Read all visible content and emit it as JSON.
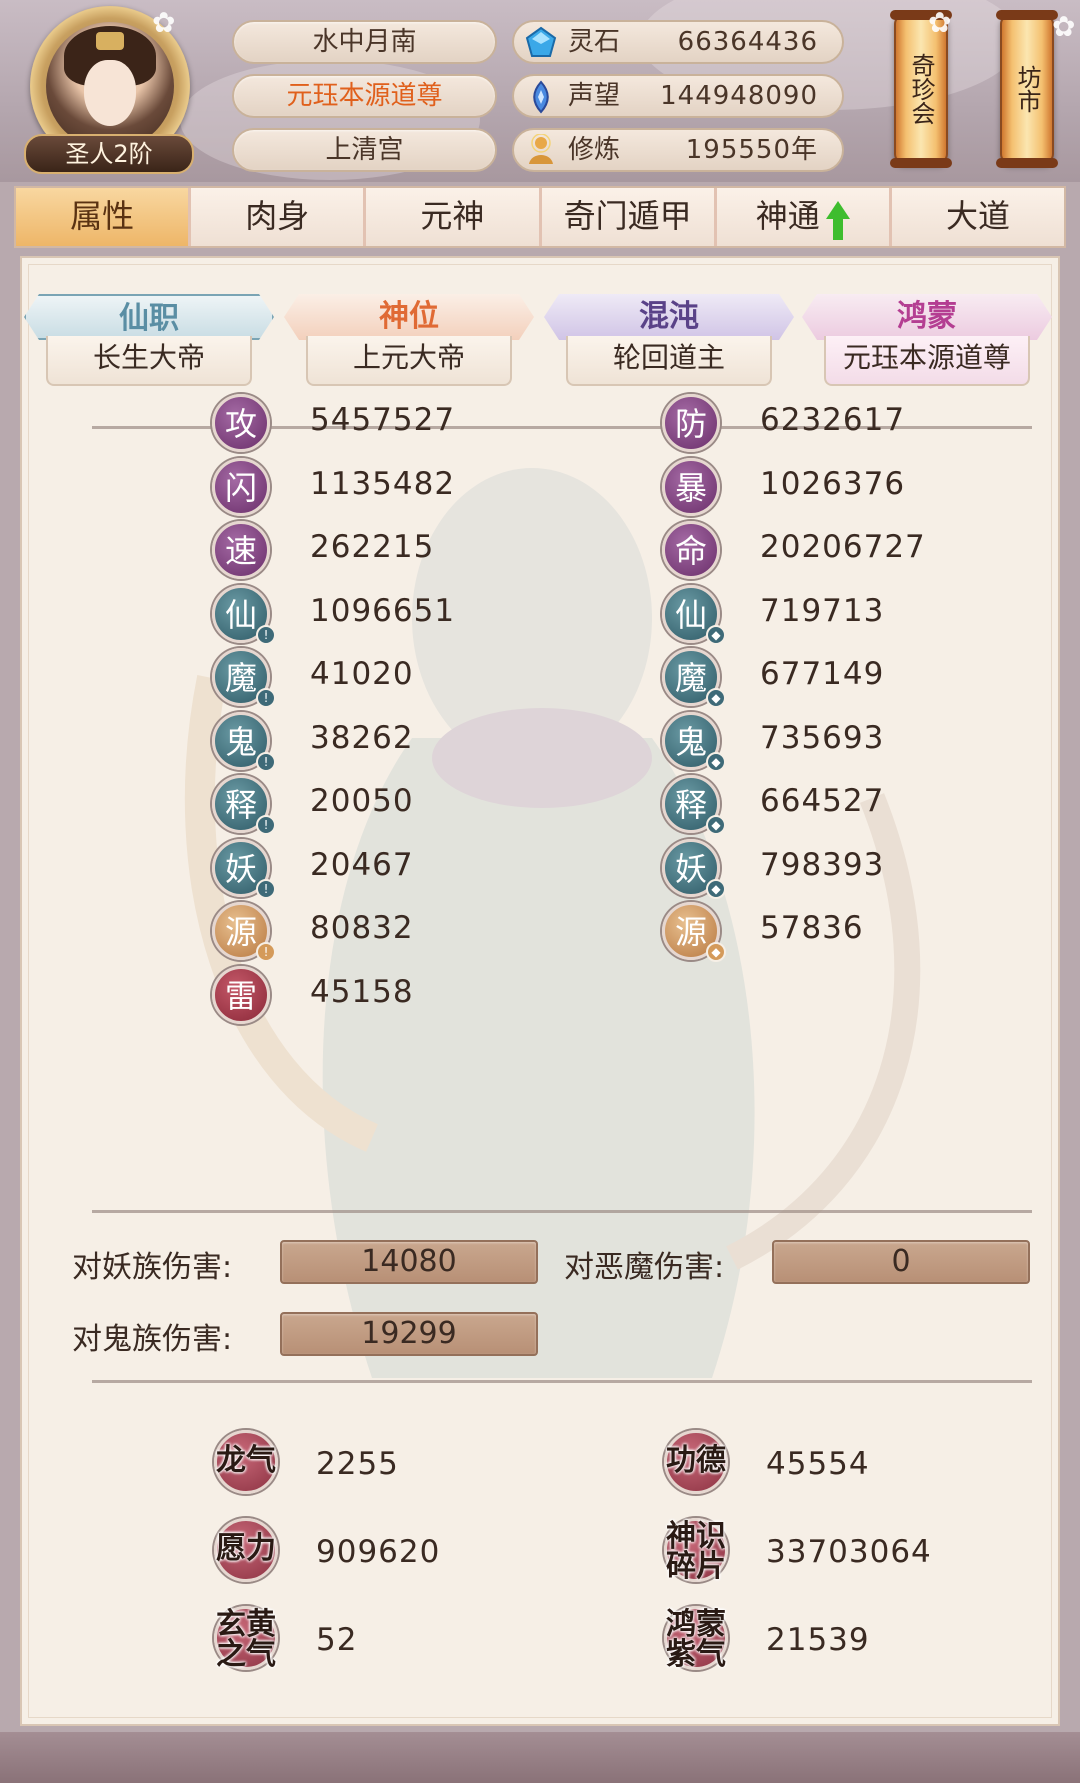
{
  "header": {
    "rank": "圣人2阶",
    "names": [
      "水中月南",
      "元珏本源道尊",
      "上清宫"
    ],
    "resources": [
      {
        "icon": "spirit-stone-icon",
        "label": "灵石",
        "value": "66364436"
      },
      {
        "icon": "reputation-icon",
        "label": "声望",
        "value": "144948090"
      },
      {
        "icon": "cultivation-icon",
        "label": "修炼",
        "value": "195550年"
      }
    ],
    "buttons": {
      "treasure": "奇珍会",
      "market": "坊市"
    }
  },
  "tabs": [
    {
      "label": "属性",
      "active": true
    },
    {
      "label": "肉身",
      "active": false
    },
    {
      "label": "元神",
      "active": false
    },
    {
      "label": "奇门遁甲",
      "active": false
    },
    {
      "label": "神通",
      "active": false,
      "upgrade_arrow": true
    },
    {
      "label": "大道",
      "active": false
    }
  ],
  "titles": [
    {
      "head": "仙职",
      "value": "长生大帝",
      "color": "#5a8ea4"
    },
    {
      "head": "神位",
      "value": "上元大帝",
      "color": "#e06a34"
    },
    {
      "head": "混沌",
      "value": "轮回道主",
      "color": "#5a4288"
    },
    {
      "head": "鸿蒙",
      "value": "元珏本源道尊",
      "color": "#b43e92"
    }
  ],
  "stats_left": [
    {
      "glyph": "攻",
      "value": "5457527",
      "style": "purple"
    },
    {
      "glyph": "闪",
      "value": "1135482",
      "style": "purple"
    },
    {
      "glyph": "速",
      "value": "262215",
      "style": "purple"
    },
    {
      "glyph": "仙",
      "value": "1096651",
      "style": "teal",
      "badge": "attack"
    },
    {
      "glyph": "魔",
      "value": "41020",
      "style": "teal",
      "badge": "attack"
    },
    {
      "glyph": "鬼",
      "value": "38262",
      "style": "teal",
      "badge": "attack"
    },
    {
      "glyph": "释",
      "value": "20050",
      "style": "teal",
      "badge": "attack"
    },
    {
      "glyph": "妖",
      "value": "20467",
      "style": "teal",
      "badge": "attack"
    },
    {
      "glyph": "源",
      "value": "80832",
      "style": "gold",
      "badge": "attack"
    },
    {
      "glyph": "雷",
      "value": "45158",
      "style": "red"
    }
  ],
  "stats_right": [
    {
      "glyph": "防",
      "value": "6232617",
      "style": "purple"
    },
    {
      "glyph": "暴",
      "value": "1026376",
      "style": "purple"
    },
    {
      "glyph": "命",
      "value": "20206727",
      "style": "purple"
    },
    {
      "glyph": "仙",
      "value": "719713",
      "style": "teal",
      "badge": "defense"
    },
    {
      "glyph": "魔",
      "value": "677149",
      "style": "teal",
      "badge": "defense"
    },
    {
      "glyph": "鬼",
      "value": "735693",
      "style": "teal",
      "badge": "defense"
    },
    {
      "glyph": "释",
      "value": "664527",
      "style": "teal",
      "badge": "defense"
    },
    {
      "glyph": "妖",
      "value": "798393",
      "style": "teal",
      "badge": "defense"
    },
    {
      "glyph": "源",
      "value": "57836",
      "style": "gold",
      "badge": "defense"
    }
  ],
  "damage": {
    "vs_demon_clan_label": "对妖族伤害:",
    "vs_demon_clan_value": "14080",
    "vs_devil_label": "对恶魔伤害:",
    "vs_devil_value": "0",
    "vs_ghost_clan_label": "对鬼族伤害:",
    "vs_ghost_clan_value": "19299"
  },
  "bottom_stats": [
    {
      "label": "龙气",
      "value": "2255"
    },
    {
      "label": "功德",
      "value": "45554"
    },
    {
      "label": "愿力",
      "value": "909620"
    },
    {
      "label": "神识碎片",
      "value": "33703064"
    },
    {
      "label": "玄黄之气",
      "value": "52"
    },
    {
      "label": "鸿蒙紫气",
      "value": "21539"
    }
  ],
  "colors": {
    "active_tab": "#eeb668",
    "panel_bg": "#f6efe6",
    "orange_name": "#e0601c",
    "upgrade_arrow": "#3ebd2e"
  }
}
